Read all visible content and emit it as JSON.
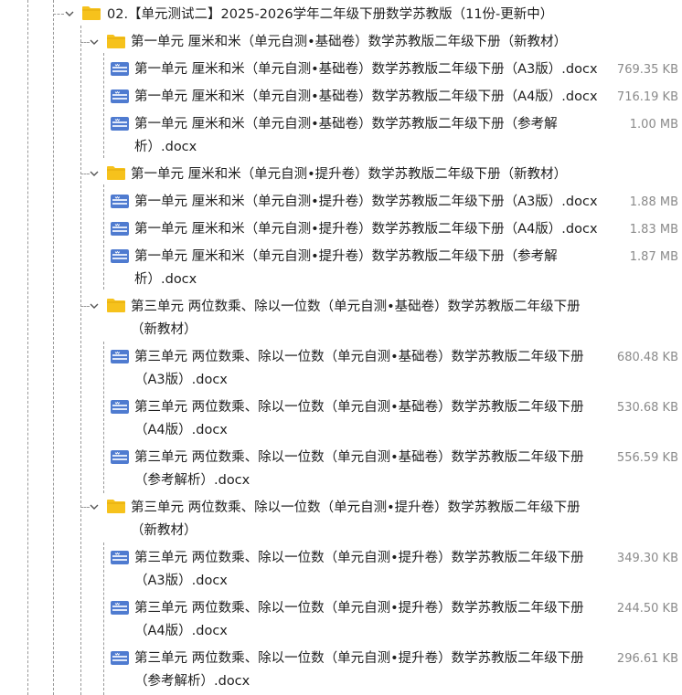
{
  "colors": {
    "folder": "#f6c21c",
    "file_icon": "#4f7bd0",
    "size_text": "#8a8a8a",
    "guide": "#9a9a9a"
  },
  "icons": {
    "expand": "chevron-down-icon",
    "folder": "folder-icon",
    "file": "word-document-icon"
  },
  "tree": {
    "root": {
      "label": "02.【单元测试二】2025-2026学年二年级下册数学苏教版（11份-更新中）"
    },
    "folders": [
      {
        "label": "第一单元 厘米和米（单元自测•基础卷）数学苏教版二年级下册（新教材）",
        "files": [
          {
            "name": "第一单元 厘米和米（单元自测•基础卷）数学苏教版二年级下册（A3版）.docx",
            "size": "769.35 KB"
          },
          {
            "name": "第一单元 厘米和米（单元自测•基础卷）数学苏教版二年级下册（A4版）.docx",
            "size": "716.19 KB"
          },
          {
            "name_line1": "第一单元 厘米和米（单元自测•基础卷）数学苏教版二年级下册（参考解",
            "name_line2": "析）.docx",
            "size": "1.00 MB"
          }
        ]
      },
      {
        "label": "第一单元 厘米和米（单元自测•提升卷）数学苏教版二年级下册（新教材）",
        "files": [
          {
            "name": "第一单元 厘米和米（单元自测•提升卷）数学苏教版二年级下册（A3版）.docx",
            "size": "1.88 MB"
          },
          {
            "name": "第一单元 厘米和米（单元自测•提升卷）数学苏教版二年级下册（A4版）.docx",
            "size": "1.83 MB"
          },
          {
            "name_line1": "第一单元 厘米和米（单元自测•提升卷）数学苏教版二年级下册（参考解",
            "name_line2": "析）.docx",
            "size": "1.87 MB"
          }
        ]
      },
      {
        "label_line1": "第三单元 两位数乘、除以一位数（单元自测•基础卷）数学苏教版二年级下册",
        "label_line2": "（新教材）",
        "files": [
          {
            "name_line1": "第三单元 两位数乘、除以一位数（单元自测•基础卷）数学苏教版二年级下册",
            "name_line2": "（A3版）.docx",
            "size": "680.48 KB"
          },
          {
            "name_line1": "第三单元 两位数乘、除以一位数（单元自测•基础卷）数学苏教版二年级下册",
            "name_line2": "（A4版）.docx",
            "size": "530.68 KB"
          },
          {
            "name_line1": "第三单元 两位数乘、除以一位数（单元自测•基础卷）数学苏教版二年级下册",
            "name_line2": "（参考解析）.docx",
            "size": "556.59 KB"
          }
        ]
      },
      {
        "label_line1": "第三单元 两位数乘、除以一位数（单元自测•提升卷）数学苏教版二年级下册",
        "label_line2": "（新教材）",
        "files": [
          {
            "name_line1": "第三单元 两位数乘、除以一位数（单元自测•提升卷）数学苏教版二年级下册",
            "name_line2": "（A3版）.docx",
            "size": "349.30 KB"
          },
          {
            "name_line1": "第三单元 两位数乘、除以一位数（单元自测•提升卷）数学苏教版二年级下册",
            "name_line2": "（A4版）.docx",
            "size": "244.50 KB"
          },
          {
            "name_line1": "第三单元 两位数乘、除以一位数（单元自测•提升卷）数学苏教版二年级下册",
            "name_line2": "（参考解析）.docx",
            "size": "296.61 KB"
          }
        ]
      }
    ]
  }
}
